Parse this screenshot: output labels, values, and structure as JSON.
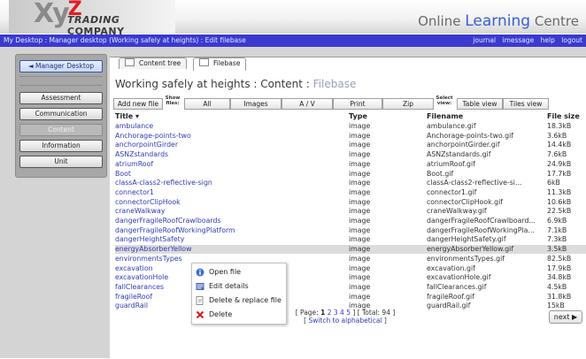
{
  "header": {
    "logo_xy": "Xy",
    "logo_z": "Z",
    "logo_trading": "TRADING",
    "logo_company": "COMPANY",
    "site_name_online": "Online",
    "site_name_learning": "Learning",
    "site_name_centre": "Centre"
  },
  "breadcrumb": "My Desktop : Manager desktop (Working safely at heights) : Edit filebase",
  "top_links": [
    "journal",
    "imessage",
    "help",
    "logout"
  ],
  "sidebar": {
    "back_label": "◄ Manager Desktop",
    "items": [
      "Assessment",
      "Communication",
      "Content",
      "Information",
      "Unit"
    ],
    "active": "Content"
  },
  "tabs": [
    {
      "label": "Content tree",
      "active": false
    },
    {
      "label": "Filebase",
      "active": true
    }
  ],
  "page_title": {
    "main": "Working safely at heights : Content : ",
    "muted": "Filebase"
  },
  "toolbar": {
    "add_new_file": "Add new file",
    "show_files_label": "Show files:",
    "filters": [
      "All",
      "Images",
      "A / V",
      "Print",
      "Zip"
    ],
    "select_view_label": "Select view:",
    "views": [
      "Table view",
      "Tiles view"
    ]
  },
  "table": {
    "columns": {
      "title": "Title ▾",
      "type": "Type",
      "filename": "Filename",
      "filesize": "File size"
    },
    "rows": [
      {
        "title": "ambulance",
        "type": "image",
        "filename": "ambulance.gif",
        "size": "18.3kB"
      },
      {
        "title": "Anchorage-points-two",
        "type": "image",
        "filename": "Anchorage-points-two.gif",
        "size": "3.6kB"
      },
      {
        "title": "anchorpointGirder",
        "type": "image",
        "filename": "anchorpointGirder.gif",
        "size": "14.4kB"
      },
      {
        "title": "ASNZstandards",
        "type": "image",
        "filename": "ASNZstandards.gif",
        "size": "7.6kB"
      },
      {
        "title": "atriumRoof",
        "type": "image",
        "filename": "atriumRoof.gif",
        "size": "24.9kB"
      },
      {
        "title": "Boot",
        "type": "image",
        "filename": "Boot.gif",
        "size": "17.7kB"
      },
      {
        "title": "classA-class2-reflective-sign",
        "type": "image",
        "filename": "classA-class2-reflective-si...",
        "size": "6kB"
      },
      {
        "title": "connector1",
        "type": "image",
        "filename": "connector1.gif",
        "size": "11.3kB"
      },
      {
        "title": "connectorClipHook",
        "type": "image",
        "filename": "connectorClipHook.gif",
        "size": "10.6kB"
      },
      {
        "title": "craneWalkway",
        "type": "image",
        "filename": "craneWalkway.gif",
        "size": "22.5kB"
      },
      {
        "title": "dangerFragileRoofCrawlboards",
        "type": "image",
        "filename": "dangerFragileRoofCrawlboard...",
        "size": "6.9kB"
      },
      {
        "title": "dangerFragileRoofWorkingPlatform",
        "type": "image",
        "filename": "dangerFragileRoofWorkingPla...",
        "size": "7.1kB"
      },
      {
        "title": "dangerHeightSafety",
        "type": "image",
        "filename": "dangerHeightSafety.gif",
        "size": "7.3kB"
      },
      {
        "title": "energyAbsorberYellow",
        "type": "image",
        "filename": "energyAbsorberYellow.gif",
        "size": "3.5kB",
        "selected": true
      },
      {
        "title": "environmentsTypes",
        "type": "image",
        "filename": "environmentsTypes.gif",
        "size": "82.5kB"
      },
      {
        "title": "excavation",
        "type": "image",
        "filename": "excavation.gif",
        "size": "17.9kB"
      },
      {
        "title": "excavationHole",
        "type": "image",
        "filename": "excavationHole.gif",
        "size": "34.8kB"
      },
      {
        "title": "fallClearances",
        "type": "image",
        "filename": "fallClearances.gif",
        "size": "4.5kB"
      },
      {
        "title": "fragileRoof",
        "type": "image",
        "filename": "fragileRoof.gif",
        "size": "31.8kB"
      },
      {
        "title": "guardRail",
        "type": "image",
        "filename": "guardRail.gif",
        "size": "15kB"
      }
    ]
  },
  "pager": {
    "prefix": "[ Page: ",
    "pages": [
      "1",
      "2",
      "3",
      "4",
      "5"
    ],
    "current": "1",
    "total_text": " ] [ Total: 94 ]",
    "switch_prefix": "[ ",
    "switch_link": "Switch to alphabetical",
    "switch_suffix": " ]",
    "next_label": "next ▶"
  },
  "context_menu": {
    "items": [
      {
        "label": "Open file",
        "icon": "info-icon"
      },
      {
        "label": "Edit details",
        "icon": "edit-icon"
      },
      {
        "label": "Delete & replace file",
        "icon": "replace-icon"
      },
      {
        "label": "Delete",
        "icon": "delete-x-icon"
      }
    ]
  },
  "colors": {
    "crumb_bar": "#3a3ad0",
    "link": "#2f3bb5",
    "logo_red": "#e31b23",
    "delete_red": "#d61a1a"
  }
}
